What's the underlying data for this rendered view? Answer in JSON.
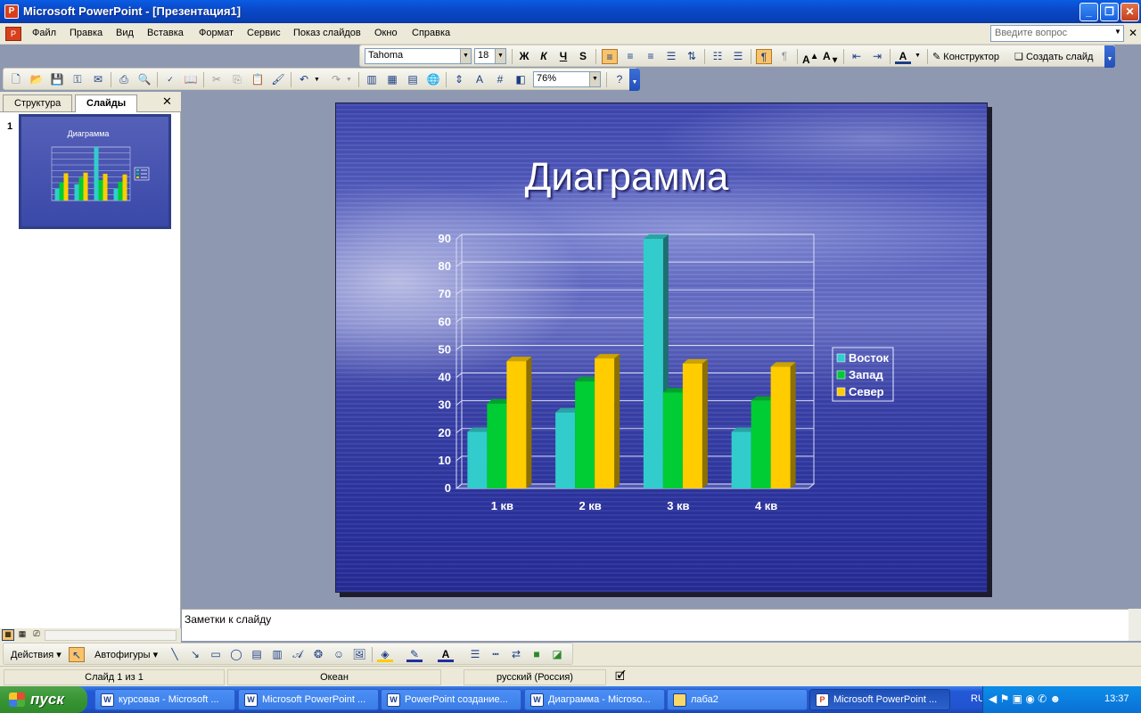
{
  "window": {
    "title": "Microsoft PowerPoint - [Презентация1]"
  },
  "menu": [
    "Файл",
    "Правка",
    "Вид",
    "Вставка",
    "Формат",
    "Сервис",
    "Показ слайдов",
    "Окно",
    "Справка"
  ],
  "help_placeholder": "Введите вопрос",
  "format_toolbar": {
    "font": "Tahoma",
    "size": "18",
    "bold": "Ж",
    "italic": "К",
    "underline": "Ч",
    "shadow": "S",
    "designer": "Конструктор",
    "new_slide": "Создать слайд"
  },
  "standard_toolbar": {
    "zoom": "76%"
  },
  "left_pane": {
    "tabs": [
      "Структура",
      "Слайды"
    ],
    "slide_number": "1",
    "thumb_title": "Диаграмма"
  },
  "slide": {
    "title": "Диаграмма"
  },
  "chart_data": {
    "type": "bar",
    "categories": [
      "1 кв",
      "2 кв",
      "3 кв",
      "4 кв"
    ],
    "series": [
      {
        "name": "Восток",
        "values": [
          20.4,
          27.4,
          90,
          20.4
        ],
        "color": "#33cccc"
      },
      {
        "name": "Запад",
        "values": [
          30.6,
          38.6,
          34.6,
          31.6
        ],
        "color": "#00cc33"
      },
      {
        "name": "Север",
        "values": [
          45.9,
          46.9,
          45,
          43.9
        ],
        "color": "#ffcc00"
      }
    ],
    "ylim": [
      0,
      90
    ],
    "yticks": [
      0,
      10,
      20,
      30,
      40,
      50,
      60,
      70,
      80,
      90
    ],
    "grid": true,
    "legend": "right"
  },
  "notes": {
    "placeholder": "Заметки к слайду"
  },
  "drawing_toolbar": {
    "actions": "Действия",
    "autoshapes": "Автофигуры"
  },
  "status": {
    "slide": "Слайд 1 из 1",
    "design": "Океан",
    "language": "русский (Россия)"
  },
  "taskbar": {
    "start": "пуск",
    "tasks": [
      "курсовая - Microsoft ...",
      "Microsoft PowerPoint ...",
      "PowerPoint создание...",
      "Диаграмма - Microso...",
      "лаба2",
      "Microsoft PowerPoint ..."
    ],
    "lang": "RU",
    "clock": "13:37"
  }
}
